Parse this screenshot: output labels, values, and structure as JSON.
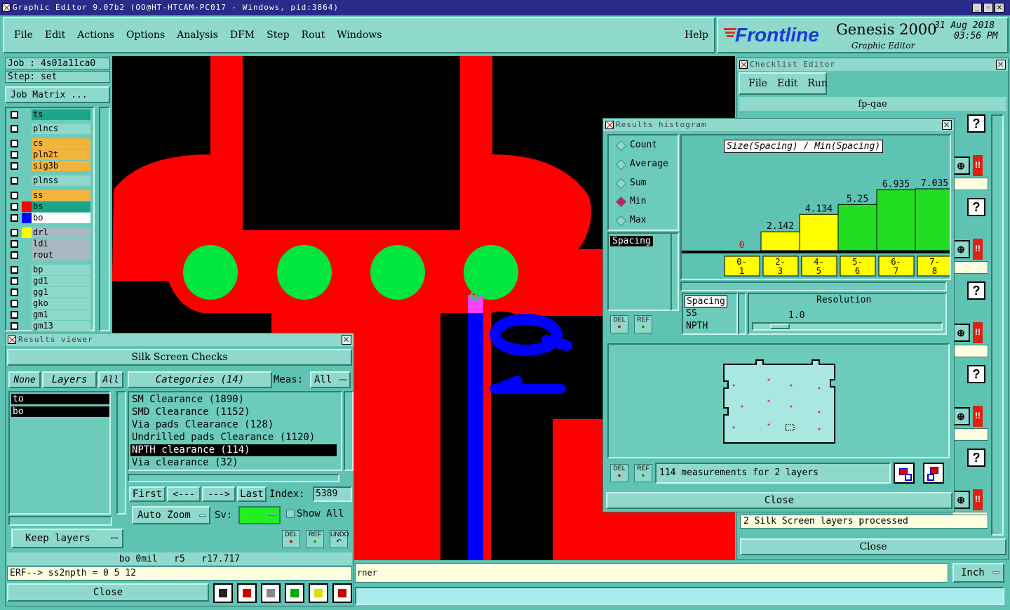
{
  "app": {
    "title": "Graphic Editor 9.07b2 (OO@HT-HTCAM-PC017 - Windows, pid:3864)"
  },
  "menubar": {
    "items": [
      "File",
      "Edit",
      "Actions",
      "Options",
      "Analysis",
      "DFM",
      "Step",
      "Rout",
      "Windows"
    ],
    "help": "Help"
  },
  "brand": {
    "logo": "Frontline",
    "product": "Genesis 2000",
    "subtitle": "Graphic Editor",
    "date": "31 Aug 2018",
    "time": "03:56 PM"
  },
  "job": {
    "job": "Job : 4s01a11ca0",
    "step": "Step: set",
    "matrix": "Job Matrix ..."
  },
  "layers": [
    {
      "name": "ts",
      "color": "#1aa58a"
    },
    {
      "name": "plncs",
      "color": "#8ed8cc"
    },
    {
      "name": "cs",
      "color": "#f2b43c"
    },
    {
      "name": "pln2t",
      "color": "#f2b43c"
    },
    {
      "name": "sig3b",
      "color": "#f2b43c"
    },
    {
      "name": "plnss",
      "color": "#8ed8cc"
    },
    {
      "name": "ss",
      "color": "#f2b43c"
    },
    {
      "name": "bs",
      "color": "#1aa58a"
    },
    {
      "name": "bo",
      "color": "#ffffff"
    },
    {
      "name": "drl",
      "color": "#a8b8c0"
    },
    {
      "name": "ldi",
      "color": "#a8b8c0"
    },
    {
      "name": "rout",
      "color": "#a8b8c0"
    },
    {
      "name": "bp",
      "color": "#8ed8cc"
    },
    {
      "name": "gd1",
      "color": "#8ed8cc"
    },
    {
      "name": "gg1",
      "color": "#8ed8cc"
    },
    {
      "name": "gko",
      "color": "#8ed8cc"
    },
    {
      "name": "gm1",
      "color": "#8ed8cc"
    },
    {
      "name": "gm13",
      "color": "#8ed8cc"
    }
  ],
  "results_viewer": {
    "title": "Results viewer",
    "header": "Silk Screen Checks",
    "none": "None",
    "layers": "Layers",
    "all": "All",
    "categories": "Categories (14)",
    "meas_label": "Meas:",
    "meas_value": "All",
    "layer_list": [
      "to",
      "bo"
    ],
    "category_list": [
      "SM Clearance (1890)",
      "SMD Clearance (1152)",
      "Via pads Clearance (128)",
      "Undrilled pads Clearance (1120)",
      "NPTH clearance (114)",
      "Via clearance (32)"
    ],
    "first": "First",
    "prev": "<---",
    "next": "--->",
    "last": "Last",
    "index_label": "Index:",
    "index_value": "5389",
    "auto_zoom": "Auto Zoom",
    "sv": "Sv:",
    "show_all": "Show All",
    "keep_layers": "Keep layers",
    "del": "DEL",
    "ref": "REF",
    "undo": "UNDO",
    "status": "bo 0mil   r5   r17.717",
    "erf": "ERF--> ss2npth = 0 5 12",
    "close": "Close"
  },
  "checklist": {
    "title": "Checklist Editor",
    "menu": [
      "File",
      "Edit",
      "Run"
    ],
    "name": "fp-qae",
    "processed": "2 Silk Screen layers processed",
    "close": "Close"
  },
  "histogram": {
    "title": "Results histogram",
    "chart_title": "Size(Spacing) / Min(Spacing)",
    "modes": [
      "Count",
      "Average",
      "Sum",
      "Min",
      "Max"
    ],
    "selected": "Min",
    "list": [
      "Spacing"
    ],
    "types": [
      "Spacing",
      "SS",
      "NPTH"
    ],
    "resolution_label": "Resolution",
    "resolution_value": "1.0",
    "measurements": "114 measurements for 2 layers",
    "close": "Close",
    "del": "DEL",
    "ref": "REF"
  },
  "chart_data": {
    "type": "bar",
    "title": "Size(Spacing) / Min(Spacing)",
    "categories": [
      "0-1",
      "2-3",
      "4-5",
      "5-6",
      "6-7",
      "7-8"
    ],
    "values": [
      0,
      2.142,
      4.134,
      5.25,
      6.935,
      7.035
    ],
    "value_labels": [
      "0",
      "2.142",
      "4.134",
      "5.25",
      "6.935",
      "7.035"
    ],
    "colors": [
      "#ffff00",
      "#ffff00",
      "#ffff00",
      "#22dd22",
      "#22dd22",
      "#22dd22"
    ]
  },
  "statusbar": {
    "fragment": "rner",
    "unit": "Inch"
  }
}
